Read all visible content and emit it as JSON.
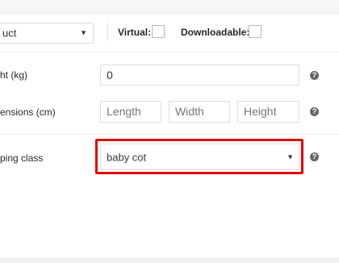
{
  "product_data": {
    "product_type": {
      "value": "uct",
      "caret": "▼"
    },
    "virtual_label": "Virtual:",
    "downloadable_label": "Downloadable:",
    "weight": {
      "label": "ht (kg)",
      "value": "0"
    },
    "dimensions": {
      "label": "ensions (cm)",
      "length_placeholder": "Length",
      "width_placeholder": "Width",
      "height_placeholder": "Height"
    },
    "shipping_class": {
      "label": "ping class",
      "value": "baby cot",
      "caret": "▼"
    },
    "help_glyph": "?"
  },
  "colors": {
    "highlight": "#e00000"
  }
}
